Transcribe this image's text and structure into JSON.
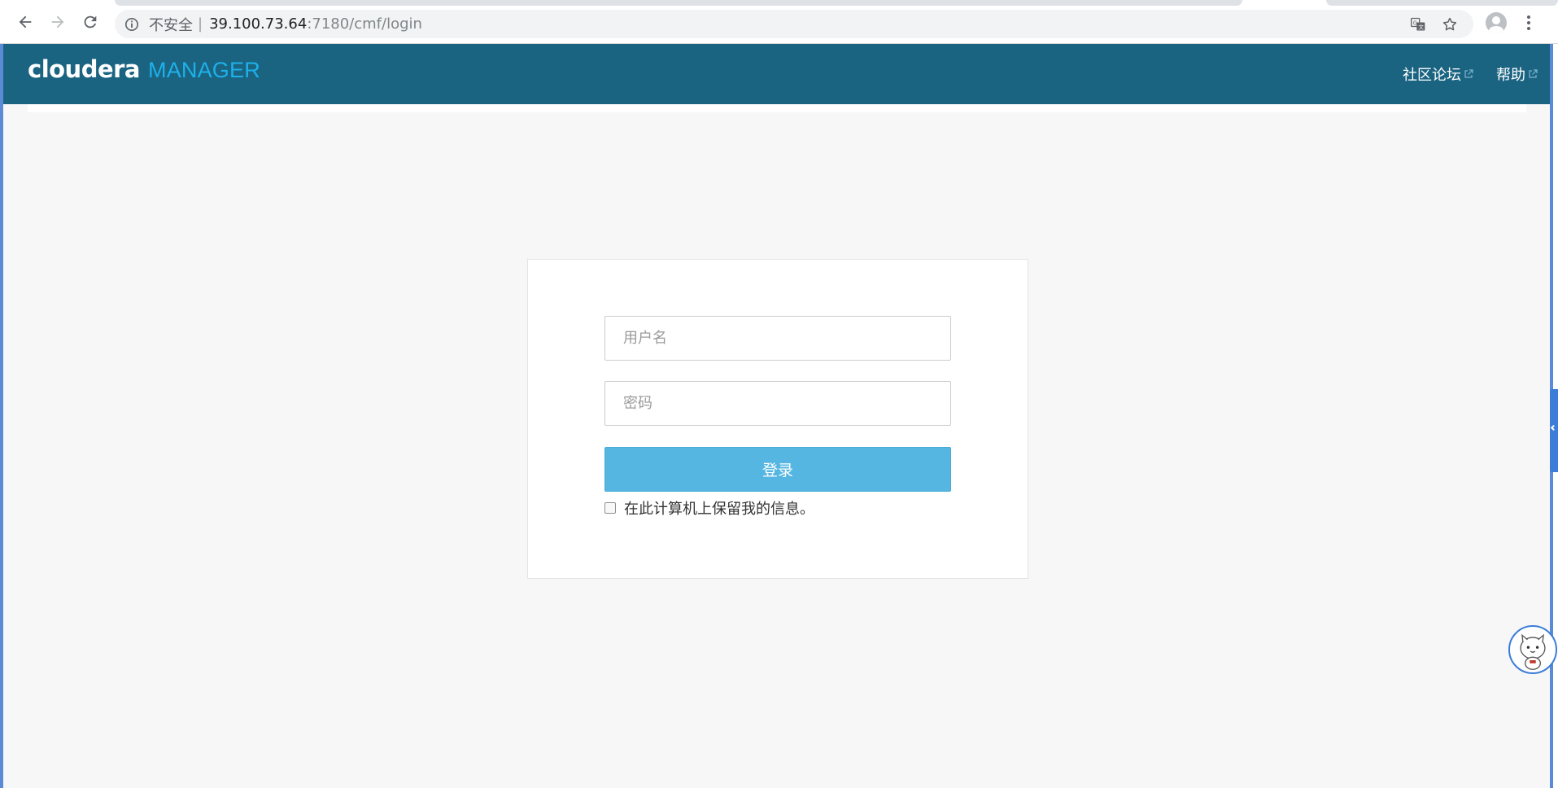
{
  "browser": {
    "security_label": "不安全",
    "separator": "|",
    "url_host": "39.100.73.64",
    "url_path": ":7180/cmf/login"
  },
  "header": {
    "logo_main": "cloudera",
    "logo_sub": "MANAGER",
    "links": [
      {
        "label": "社区论坛"
      },
      {
        "label": "帮助"
      }
    ]
  },
  "login": {
    "username_placeholder": "用户名",
    "password_placeholder": "密码",
    "submit_label": "登录",
    "remember_label": "在此计算机上保留我的信息。",
    "remember_checked": false
  },
  "colors": {
    "header_bg": "#1a6482",
    "logo_accent": "#1eb0ea",
    "button_bg": "#55b6e2",
    "page_bg": "#f7f7f7"
  }
}
